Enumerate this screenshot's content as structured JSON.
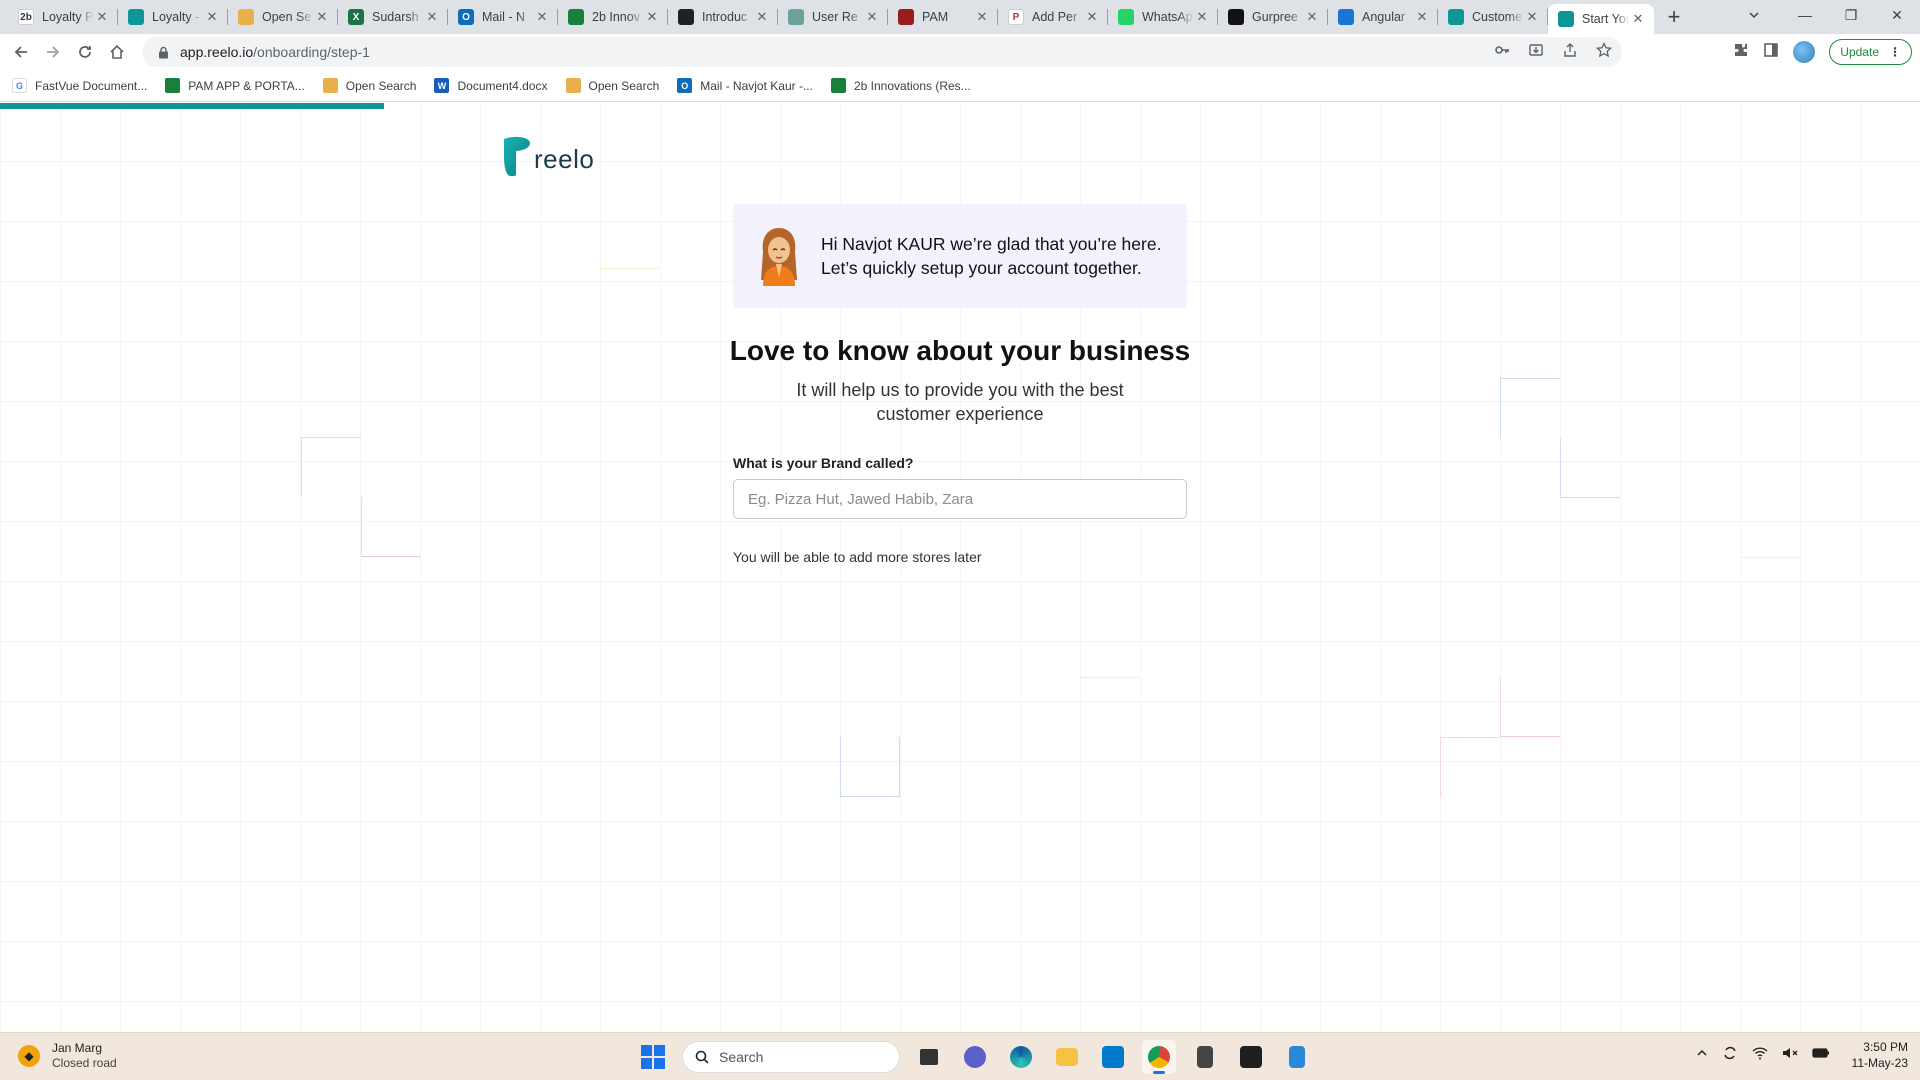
{
  "browser": {
    "tabs": [
      {
        "title": "Loyalty P",
        "favicon": "2b",
        "color": "#ffffff",
        "fg": "#333"
      },
      {
        "title": "Loyalty -",
        "favicon": "",
        "color": "#0e9595",
        "fg": "#fff"
      },
      {
        "title": "Open Se",
        "favicon": "",
        "color": "#e8b04a",
        "fg": "#fff"
      },
      {
        "title": "Sudarsh",
        "favicon": "X",
        "color": "#1e7145",
        "fg": "#fff"
      },
      {
        "title": "Mail - N",
        "favicon": "O",
        "color": "#0f6cbd",
        "fg": "#fff"
      },
      {
        "title": "2b Innov",
        "favicon": "",
        "color": "#188038",
        "fg": "#fff"
      },
      {
        "title": "Introduc",
        "favicon": "",
        "color": "#202124",
        "fg": "#fff"
      },
      {
        "title": "User Re",
        "favicon": "",
        "color": "#6aa39a",
        "fg": "#fff"
      },
      {
        "title": "PAM",
        "favicon": "",
        "color": "#9b1c1c",
        "fg": "#fff"
      },
      {
        "title": "Add Per",
        "favicon": "P",
        "color": "#ffffff",
        "fg": "#b33"
      },
      {
        "title": "WhatsAp",
        "favicon": "",
        "color": "#25d366",
        "fg": "#fff"
      },
      {
        "title": "Gurpree",
        "favicon": "",
        "color": "#111111",
        "fg": "#fff"
      },
      {
        "title": "Angular",
        "favicon": "",
        "color": "#1976d2",
        "fg": "#fff"
      },
      {
        "title": "Custome",
        "favicon": "",
        "color": "#0e9595",
        "fg": "#fff"
      },
      {
        "title": "Start You",
        "favicon": "",
        "color": "#0e9595",
        "fg": "#fff",
        "active": true
      }
    ],
    "new_tab_label": "+",
    "url_host": "app.reelo.io",
    "url_path": "/onboarding/step-1",
    "update_label": "Update",
    "bookmarks": [
      {
        "label": "FastVue Document...",
        "icon": "G",
        "color": "#ffffff",
        "fg": "#4285f4"
      },
      {
        "label": "PAM APP & PORTA...",
        "icon": "",
        "color": "#188038",
        "fg": "#fff"
      },
      {
        "label": "Open Search",
        "icon": "",
        "color": "#e8b04a",
        "fg": "#fff"
      },
      {
        "label": "Document4.docx",
        "icon": "W",
        "color": "#185abd",
        "fg": "#fff"
      },
      {
        "label": "Open Search",
        "icon": "",
        "color": "#e8b04a",
        "fg": "#fff"
      },
      {
        "label": "Mail - Navjot Kaur -...",
        "icon": "O",
        "color": "#0f6cbd",
        "fg": "#fff"
      },
      {
        "label": "2b Innovations (Res...",
        "icon": "",
        "color": "#188038",
        "fg": "#fff"
      }
    ]
  },
  "onboarding": {
    "progress": 0.2,
    "brand_name": "reelo",
    "accent": "#0e9595",
    "welcome": "Hi Navjot KAUR we’re glad that you’re here. Let’s quickly setup your account together.",
    "heading": "Love to know about your business",
    "subheading": "It will help us to provide you with the best customer experience",
    "brand_label": "What is your Brand called?",
    "brand_value": "",
    "brand_placeholder": "Eg. Pizza Hut, Jawed Habib, Zara",
    "helper": "You will be able to add more stores later"
  },
  "taskbar": {
    "weather_title": "Jan Marg",
    "weather_sub": "Closed road",
    "search_label": "Search",
    "time": "3:50 PM",
    "date": "11-May-23"
  }
}
